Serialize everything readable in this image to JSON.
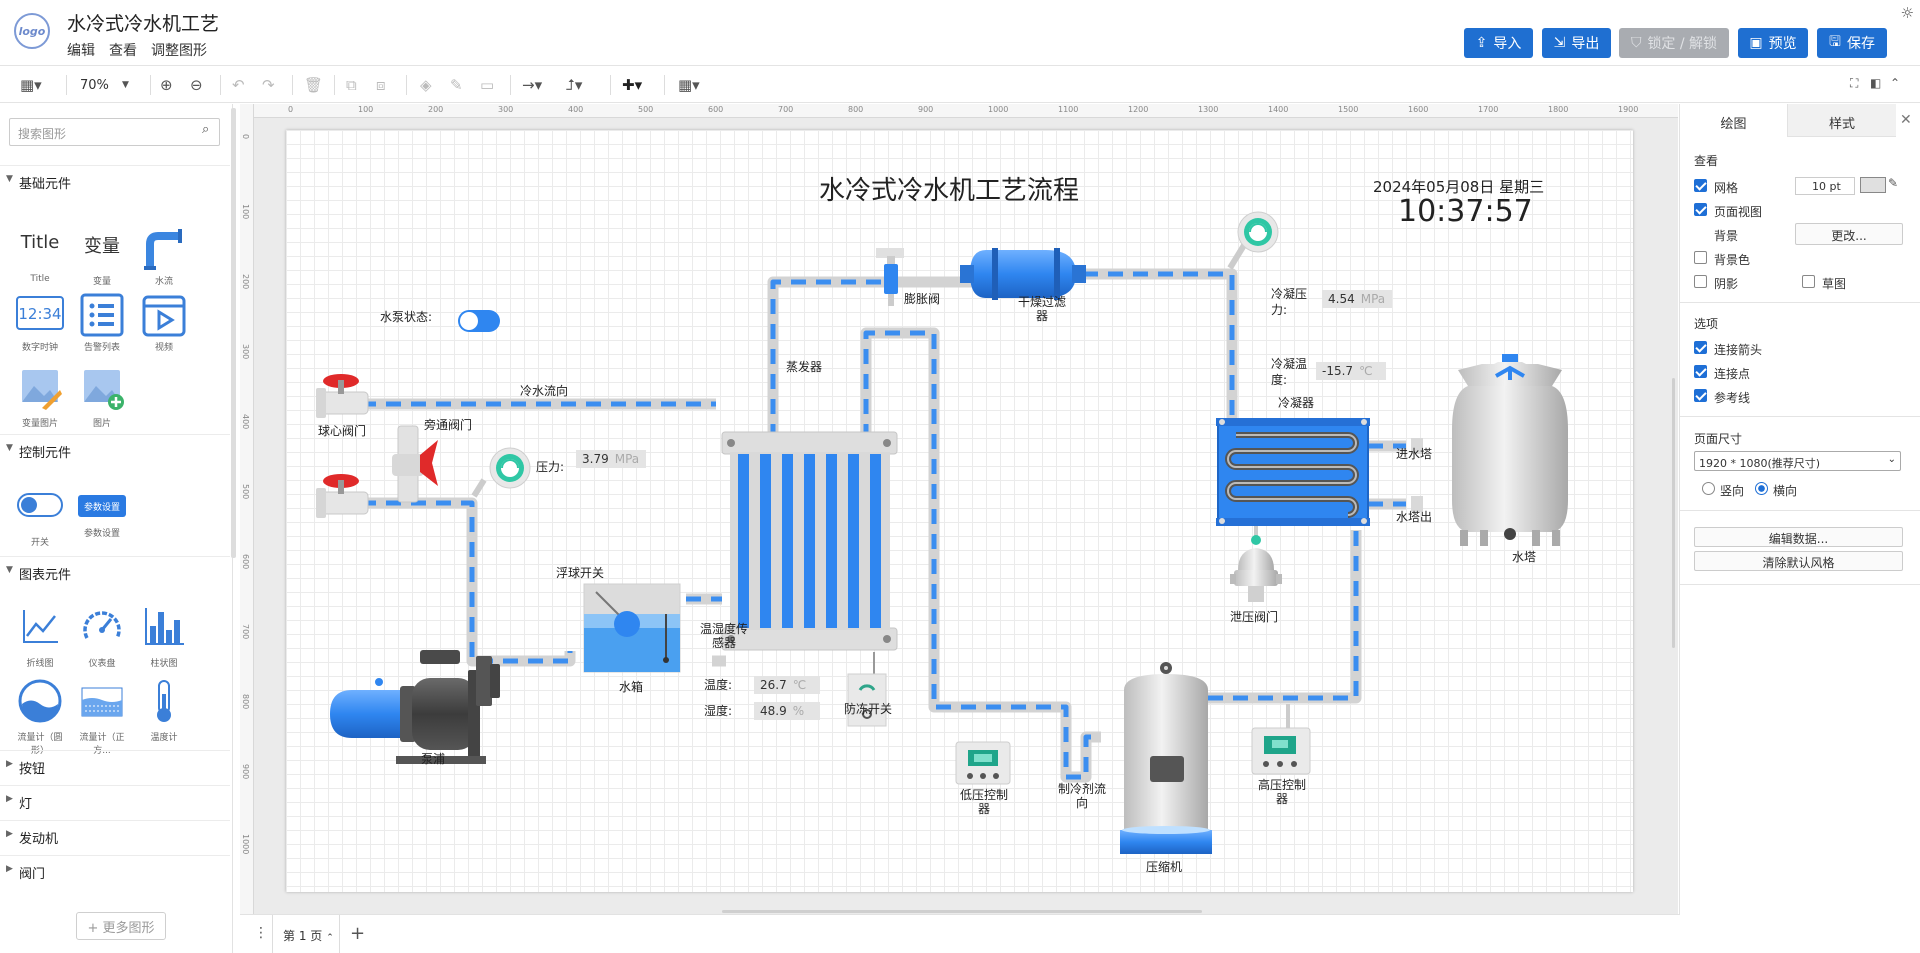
{
  "app": {
    "logo_text": "logo",
    "title": "水冷式冷水机工艺",
    "menu": [
      "编辑",
      "查看",
      "调整图形"
    ],
    "buttons": {
      "import": "导入",
      "export": "导出",
      "lock": "锁定 / 解锁",
      "preview": "预览",
      "save": "保存"
    }
  },
  "toolbar": {
    "zoom": "70%"
  },
  "ruler": {
    "h": [
      "0",
      "100",
      "200",
      "300",
      "400",
      "500",
      "600",
      "700",
      "800",
      "900",
      "1000",
      "1100",
      "1200",
      "1300",
      "1400",
      "1500",
      "1600",
      "1700",
      "1800",
      "1900"
    ],
    "v": [
      "0",
      "100",
      "200",
      "300",
      "400",
      "500",
      "600",
      "700",
      "800",
      "900",
      "1000"
    ]
  },
  "left": {
    "search_placeholder": "搜索图形",
    "sections": {
      "basic": "基础元件",
      "control": "控制元件",
      "chart": "图表元件",
      "button": "按钮",
      "light": "灯",
      "engine": "发动机",
      "valve": "阀门"
    },
    "basic_items": [
      "Title",
      "变量",
      "水流",
      "数字时钟",
      "告警列表",
      "视频",
      "变量图片",
      "图片"
    ],
    "basic_title_glyph": "Title",
    "basic_var_glyph": "变量",
    "clock_glyph": "12:34",
    "control_items": [
      "开关",
      "参数设置"
    ],
    "param_glyph": "参数设置",
    "chart_items": [
      "折线图",
      "仪表盘",
      "柱状图",
      "流量计（圆形）",
      "流量计（正方...",
      "温度计"
    ],
    "more": "+ 更多图形"
  },
  "canvas": {
    "title": "水冷式冷水机工艺流程",
    "date": "2024年05月08日 星期三",
    "time": "10:37:57",
    "labels": {
      "pump_status": "水泵状态:",
      "cold_flow": "冷水流向",
      "ball_valve": "球心阀门",
      "bypass_valve": "旁通阀门",
      "pressure": "压力:",
      "float_switch": "浮球开关",
      "tank": "水箱",
      "pump": "泵浦",
      "evaporator": "蒸发器",
      "expansion_valve": "膨胀阀",
      "filter": "干燥过滤器",
      "th_sensor": "温湿度传感器",
      "temp": "温度:",
      "humidity": "湿度:",
      "antifreeze": "防冻开关",
      "low_ctrl": "低压控制器",
      "refrig_flow": "制冷剂流向",
      "compressor": "压缩机",
      "high_ctrl": "高压控制器",
      "cond_pressure": "冷凝压力:",
      "cond_temp": "冷凝温度:",
      "condenser": "冷凝器",
      "relief_valve": "泄压阀门",
      "water_in": "进水塔",
      "water_out": "水塔出",
      "tower": "水塔"
    },
    "values": {
      "pressure": {
        "value": "3.79",
        "unit": "MPa"
      },
      "temp": {
        "value": "26.7",
        "unit": "℃"
      },
      "humidity": {
        "value": "48.9",
        "unit": "%"
      },
      "cond_pressure": {
        "value": "4.54",
        "unit": "MPa"
      },
      "cond_temp": {
        "value": "-15.7",
        "unit": "℃"
      }
    }
  },
  "right": {
    "tabs": {
      "draw": "绘图",
      "style": "样式"
    },
    "view": "查看",
    "grid": "网格",
    "grid_size": "10 pt",
    "page_view": "页面视图",
    "background": "背景",
    "change": "更改...",
    "bg_color": "背景色",
    "shadow": "阴影",
    "sketch": "草图",
    "options": "选项",
    "connect_arrows": "连接箭头",
    "connect_points": "连接点",
    "guides": "参考线",
    "page_size": "页面尺寸",
    "page_size_value": "1920 * 1080(推荐尺寸)",
    "portrait": "竖向",
    "landscape": "横向",
    "edit_data": "编辑数据...",
    "clear_style": "清除默认风格"
  },
  "bottom": {
    "page_tab": "第 1 页"
  },
  "colors": {
    "primary": "#1f6fd1",
    "pipe_blue": "#3b8ef0",
    "pipe_grey": "#d4d4d4",
    "disabled": "#a9acb1"
  }
}
